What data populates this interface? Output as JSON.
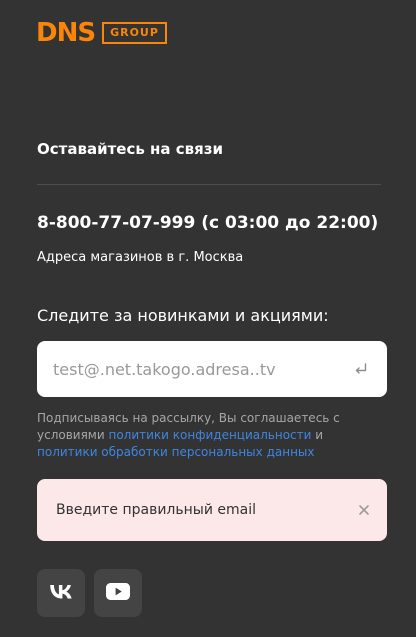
{
  "logo": {
    "brand": "DNS",
    "suffix": "GROUP"
  },
  "contacts": {
    "title": "Оставайтесь на связи",
    "phone": "8-800-77-07-999 (с 03:00 до 22:00)",
    "stores_link": "Адреса магазинов в г. Москва"
  },
  "subscribe": {
    "heading": "Следите за новинками и акциями:",
    "email_value": "test@.net.takogo.adresa..tv",
    "submit_icon": "enter-return-icon",
    "disclaimer_text_1": "Подписываясь на рассылку, Вы соглашаетесь с условиями ",
    "privacy_link": "политики конфиденциальности",
    "disclaimer_and": " и ",
    "data_policy_link": "политики обработки персональных данных"
  },
  "error": {
    "message": "Введите правильный email",
    "close_icon": "close-icon"
  },
  "social": [
    {
      "name": "vk-icon"
    },
    {
      "name": "youtube-icon"
    }
  ],
  "colors": {
    "background": "#333333",
    "brand_orange": "#fc8507",
    "link_blue": "#3e86e0",
    "error_bg": "#fce8e8"
  }
}
